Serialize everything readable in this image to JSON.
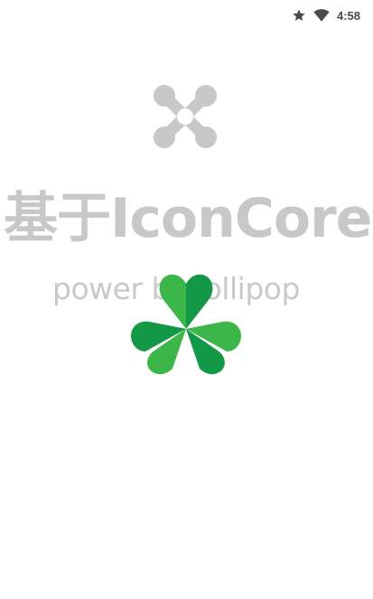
{
  "status_bar": {
    "time": "4:58",
    "icons": [
      "star-icon",
      "wifi-icon"
    ]
  },
  "splash": {
    "logo": "connection-x-logo-icon",
    "title": "基于IconCore",
    "subtitle": "power by lollipop",
    "mascot": "clover-icon",
    "colors": {
      "text_gray": "#c8c8c8",
      "clover_dark": "#139847",
      "clover_light": "#3cb649"
    }
  }
}
